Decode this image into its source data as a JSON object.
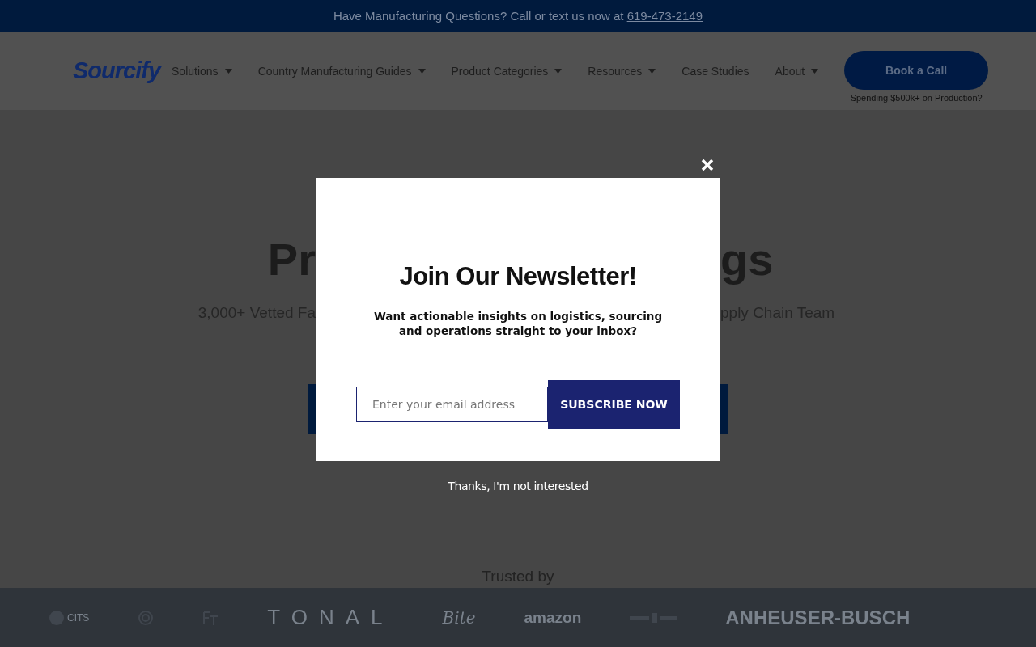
{
  "announcement": {
    "text": "Have Manufacturing Questions? Call or text us now at ",
    "phone": "619-473-2149"
  },
  "header": {
    "logo": "Sourcify",
    "nav": [
      {
        "label": "Solutions",
        "dropdown": true
      },
      {
        "label": "Country Manufacturing Guides",
        "dropdown": true
      },
      {
        "label": "Product Categories",
        "dropdown": true
      },
      {
        "label": "Resources",
        "dropdown": true
      },
      {
        "label": "Case Studies",
        "dropdown": false
      },
      {
        "label": "About",
        "dropdown": true
      }
    ],
    "cta": {
      "label": "Book a Call",
      "caption": "Spending $500k+ on Production?"
    }
  },
  "hero": {
    "title_left": "Pr",
    "title_right": "gs",
    "subtitle_left": "3,000+ Vetted Fa",
    "subtitle_right": "pply Chain Team"
  },
  "popup": {
    "title": "Join Our Newsletter!",
    "text": "Want actionable insights on logistics, sourcing and operations straight to your inbox?",
    "email_placeholder": "Enter your email address",
    "button": "SUBSCRIBE NOW",
    "dismiss": "Thanks, I'm not interested"
  },
  "trusted": {
    "label": "Trusted by",
    "logos": [
      {
        "kind": "circle",
        "text": "CITS"
      },
      {
        "kind": "ring"
      },
      {
        "kind": "ft"
      },
      {
        "kind": "wide",
        "text": "TONAL"
      },
      {
        "kind": "script",
        "text": "Bite"
      },
      {
        "kind": "amazon",
        "text": "amazon"
      },
      {
        "kind": "bar"
      },
      {
        "kind": "bold",
        "text": "ANHEUSER-BUSCH"
      }
    ]
  }
}
